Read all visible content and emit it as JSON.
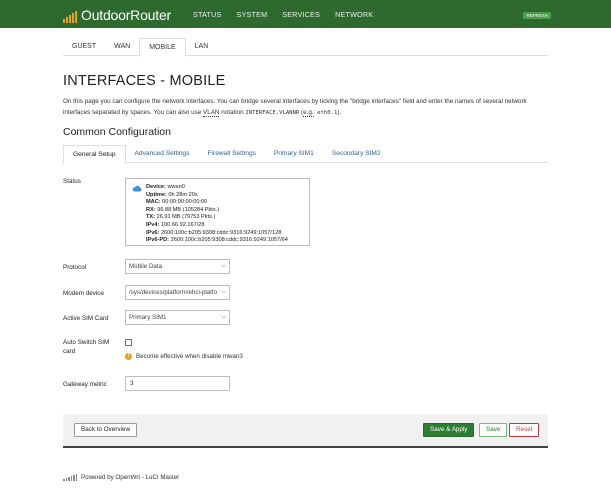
{
  "header": {
    "brand": "OutdoorRouter",
    "menu": [
      "STATUS",
      "SYSTEM",
      "SERVICES",
      "NETWORK"
    ],
    "refresh_label": "REFRESH",
    "colors": {
      "bar": "#2e6a2e",
      "logo_accent": "#e9a21b"
    }
  },
  "top_tabs": [
    {
      "label": "GUEST",
      "active": false
    },
    {
      "label": "WAN",
      "active": false
    },
    {
      "label": "MOBILE",
      "active": true
    },
    {
      "label": "LAN",
      "active": false
    }
  ],
  "page": {
    "title": "INTERFACES - MOBILE",
    "desc_part1": "On this page you can configure the network interfaces. You can bridge several interfaces by ticking the \"bridge interfaces\" field and enter the names of several network interfaces separated by spaces. You can also use ",
    "desc_abbr": "VLAN",
    "desc_part2": " notation ",
    "desc_code1": "INTERFACE.VLANNR",
    "desc_part3": " (",
    "desc_eg": "e.g.",
    "desc_part4": ": ",
    "desc_code2": "eth0.1",
    "desc_part5": ").",
    "section_title": "Common Configuration"
  },
  "section_tabs": [
    {
      "label": "General Setup",
      "active": true
    },
    {
      "label": "Advanced Settings",
      "active": false
    },
    {
      "label": "Firewall Settings",
      "active": false
    },
    {
      "label": "Primary SIM1",
      "active": false
    },
    {
      "label": "Secondary SIM2",
      "active": false
    }
  ],
  "status": {
    "label": "Status",
    "device_key": "Device:",
    "device_val": "wwan0",
    "uptime_key": "Uptime:",
    "uptime_val": "0h 28m 20s",
    "mac_key": "MAC:",
    "mac_val": "00:00:00:00:00:00",
    "rx_key": "RX:",
    "rx_val": "96.88 MB (105284 Pkts.)",
    "tx_key": "TX:",
    "tx_val": "26.91 MB (79753 Pkts.)",
    "ipv4_key": "IPv4:",
    "ipv4_val": "100.66.92.167/28",
    "ipv6_key": "IPv6:",
    "ipv6_val": "2600:100c:b205:9308:cddc:9316:9249:1057/128",
    "ipv6pd_key": "IPv6-PD:",
    "ipv6pd_val": "2600:100c:b205:9308:cddc:9316:9249:1057/64",
    "icon": "cloud-icon"
  },
  "form": {
    "protocol_label": "Protocol",
    "protocol_value": "Mobile Data",
    "modem_label": "Modem device",
    "modem_value": "/sys/devices/platform/ehci-platfo",
    "sim_label": "Active SIM Card",
    "sim_value": "Primary SIM1",
    "autoswitch_label": "Auto Switch SIM card",
    "autoswitch_checked": false,
    "autoswitch_hint": "Become effective when disable mwan3",
    "metric_label": "Gateway metric",
    "metric_value": "3"
  },
  "actions": {
    "back": "Back to Overview",
    "save_apply": "Save & Apply",
    "save": "Save",
    "reset": "Reset"
  },
  "footer": {
    "powered": "Powered by OpenWrt - LuCI Master"
  }
}
